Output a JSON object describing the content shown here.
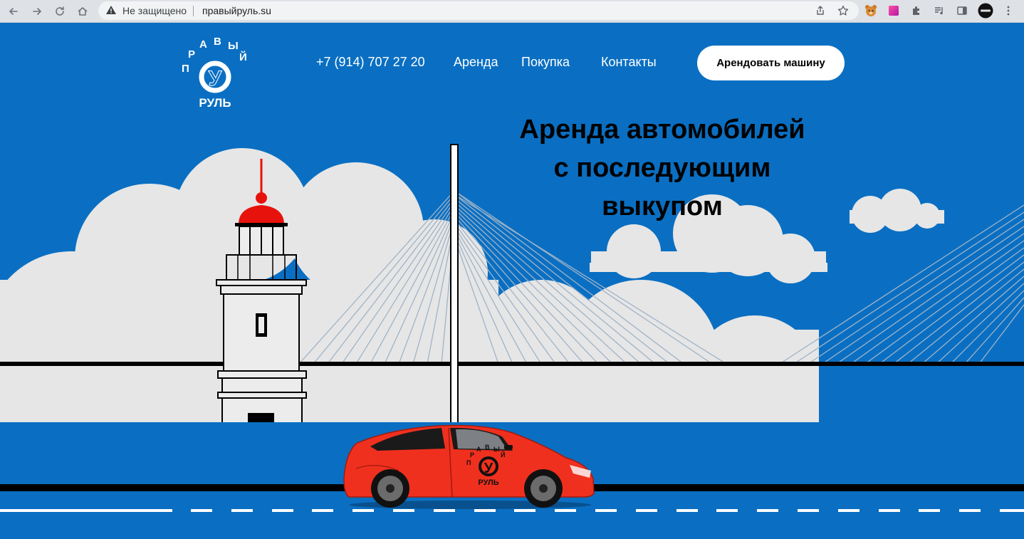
{
  "browser": {
    "security_status": "Не защищено",
    "url": "правыйруль.su"
  },
  "header": {
    "logo": {
      "top_text": "ПРАВЫЙ",
      "bottom_text": "РУЛЬ",
      "letter": "У"
    },
    "phone": "+7 (914) 707 27 20",
    "nav": [
      {
        "label": "Аренда"
      },
      {
        "label": "Покупка"
      },
      {
        "label": "Контакты"
      }
    ],
    "cta_label": "Арендовать машину"
  },
  "hero": {
    "title_line1": "Аренда автомобилей",
    "title_line2": "с последующим",
    "title_line3": "выкупом"
  },
  "car_logo": {
    "top_text": "ПРАВЫЙ",
    "bottom_text": "РУЛЬ",
    "letter": "У"
  },
  "colors": {
    "sky": "#0a6fc2",
    "cloud": "#e8e8e8",
    "car": "#f0301e",
    "lighthouse_dome": "#e8120c",
    "cable": "#a9b7c6"
  }
}
